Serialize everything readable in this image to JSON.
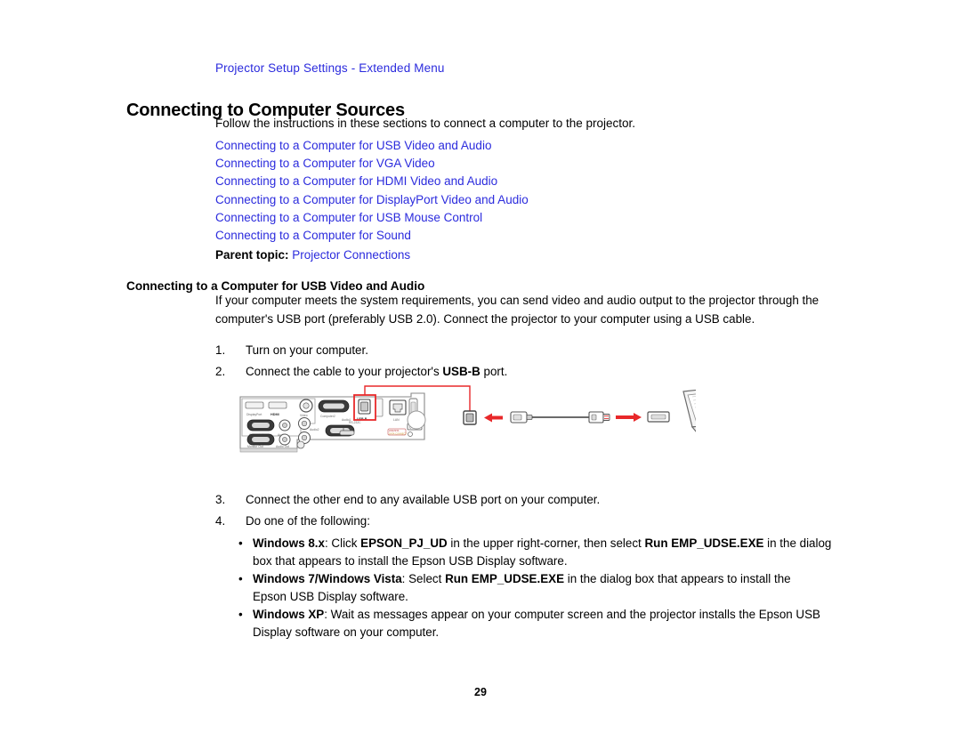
{
  "document": {
    "breadcrumb": "Projector Setup Settings - Extended Menu",
    "title": "Connecting to Computer Sources",
    "intro": "Follow the instructions in these sections to connect a computer to the projector.",
    "page_number": "29",
    "link_color": "#2b2bdd",
    "accent_color": "#e8282a",
    "background_color": "#ffffff"
  },
  "toc_links": [
    "Connecting to a Computer for USB Video and Audio",
    "Connecting to a Computer for VGA Video",
    "Connecting to a Computer for HDMI Video and Audio",
    "Connecting to a Computer for DisplayPort Video and Audio",
    "Connecting to a Computer for USB Mouse Control",
    "Connecting to a Computer for Sound"
  ],
  "parent_topic": {
    "label": "Parent topic:",
    "link": "Projector Connections"
  },
  "section": {
    "heading": "Connecting to a Computer for USB Video and Audio",
    "paragraph_part1": "If your computer meets the system requirements, you can send video and audio output to the projector through the computer's USB port (preferably USB 2.0). Connect the projector to your computer using a USB cable."
  },
  "steps": [
    {
      "number": "1.",
      "text_before": "Turn on your computer.",
      "bold": "",
      "text_after": ""
    },
    {
      "number": "2.",
      "text_before": "Connect the cable to your projector's ",
      "bold": "USB-B",
      "text_after": " port."
    },
    {
      "number": "3.",
      "text_before": "Connect the other end to any available USB port on your computer.",
      "bold": "",
      "text_after": ""
    },
    {
      "number": "4.",
      "text_before": "Do one of the following:",
      "bold": "",
      "text_after": ""
    }
  ],
  "bullets": [
    {
      "marker": "•",
      "bold1": "Windows 8.x",
      "mid1": ": Click ",
      "bold2": "EPSON_PJ_UD",
      "mid2": " in the upper right-corner, then select ",
      "bold3": "Run EMP_UDSE.EXE",
      "tail": " in the dialog box that appears to install the Epson USB Display software."
    },
    {
      "marker": "•",
      "bold1": "Windows 7/Windows Vista",
      "mid1": ": Select ",
      "bold2": "Run EMP_UDSE.EXE",
      "mid2": "",
      "bold3": "",
      "tail": " in the dialog box that appears to install the Epson USB Display software."
    },
    {
      "marker": "•",
      "bold1": "Windows XP",
      "mid1": ": Wait as messages appear on your computer screen and the projector installs the Epson USB Display software on your computer.",
      "bold2": "",
      "mid2": "",
      "bold3": "",
      "tail": ""
    }
  ],
  "figure": {
    "name": "projector-usb-connection-diagram",
    "description": "Projector rear connector panel with USB-B port highlighted in red, connected by a USB cable to a laptop",
    "panel_labels": [
      "Computer1",
      "Computer2",
      "HDMI",
      "DisplayPort",
      "Video",
      "Audio",
      "Audio1",
      "Audio2",
      "Monitor Out",
      "Audio Out",
      "RS-232C",
      "USB-B",
      "LAN",
      "USB-A"
    ],
    "highlight_port": "USB-B",
    "callout_color": "#e8282a"
  }
}
